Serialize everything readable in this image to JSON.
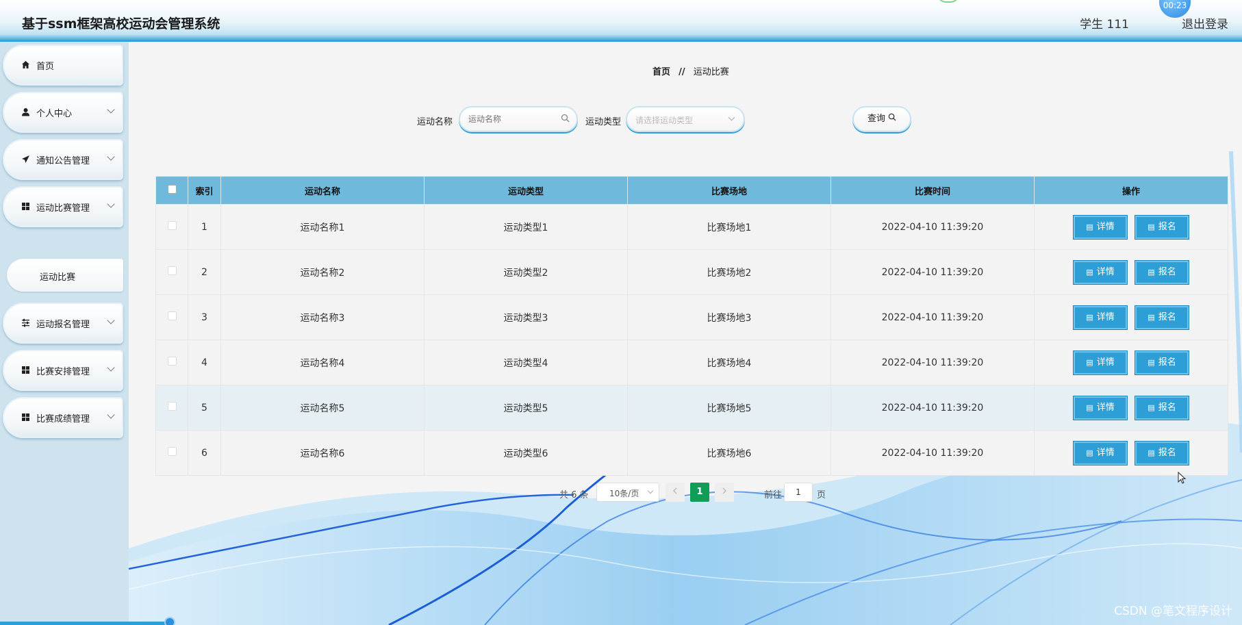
{
  "app": {
    "title": "基于ssm框架高校运动会管理系统",
    "user": "学生 111",
    "logout": "退出登录",
    "timer": "00:23"
  },
  "sidebar": {
    "items": [
      {
        "label": "首页",
        "icon": "home-icon"
      },
      {
        "label": "个人中心",
        "icon": "user-icon"
      },
      {
        "label": "通知公告管理",
        "icon": "send-icon"
      },
      {
        "label": "运动比赛管理",
        "icon": "grid-icon"
      },
      {
        "label": "运动报名管理",
        "icon": "sliders-icon"
      },
      {
        "label": "比赛安排管理",
        "icon": "grid-icon"
      },
      {
        "label": "比赛成绩管理",
        "icon": "grid-icon"
      }
    ],
    "submenu": {
      "label": "运动比赛"
    }
  },
  "breadcrumb": {
    "home": "首页",
    "separator": "//",
    "current": "运动比赛"
  },
  "search": {
    "name_label": "运动名称",
    "name_placeholder": "运动名称",
    "type_label": "运动类型",
    "type_placeholder": "请选择运动类型",
    "button": "查询"
  },
  "table": {
    "headers": [
      "索引",
      "运动名称",
      "运动类型",
      "比赛场地",
      "比赛时间",
      "操作"
    ],
    "rows": [
      {
        "index": "1",
        "name": "运动名称1",
        "type": "运动类型1",
        "venue": "比赛场地1",
        "time": "2022-04-10 11:39:20"
      },
      {
        "index": "2",
        "name": "运动名称2",
        "type": "运动类型2",
        "venue": "比赛场地2",
        "time": "2022-04-10 11:39:20"
      },
      {
        "index": "3",
        "name": "运动名称3",
        "type": "运动类型3",
        "venue": "比赛场地3",
        "time": "2022-04-10 11:39:20"
      },
      {
        "index": "4",
        "name": "运动名称4",
        "type": "运动类型4",
        "venue": "比赛场地4",
        "time": "2022-04-10 11:39:20"
      },
      {
        "index": "5",
        "name": "运动名称5",
        "type": "运动类型5",
        "venue": "比赛场地5",
        "time": "2022-04-10 11:39:20"
      },
      {
        "index": "6",
        "name": "运动名称6",
        "type": "运动类型6",
        "venue": "比赛场地6",
        "time": "2022-04-10 11:39:20"
      }
    ],
    "detail_label": "详情",
    "signup_label": "报名"
  },
  "pagination": {
    "total": "共 6 条",
    "page_size": "10条/页",
    "current_page": "1",
    "goto_label": "前往",
    "goto_value": "1",
    "goto_unit": "页"
  },
  "watermark": "CSDN @笔文程序设计",
  "colors": {
    "accent": "#2ba0d8",
    "table_header": "#6fb9dc",
    "action_button": "#2d9fd6",
    "page_active": "#0f9d58"
  }
}
